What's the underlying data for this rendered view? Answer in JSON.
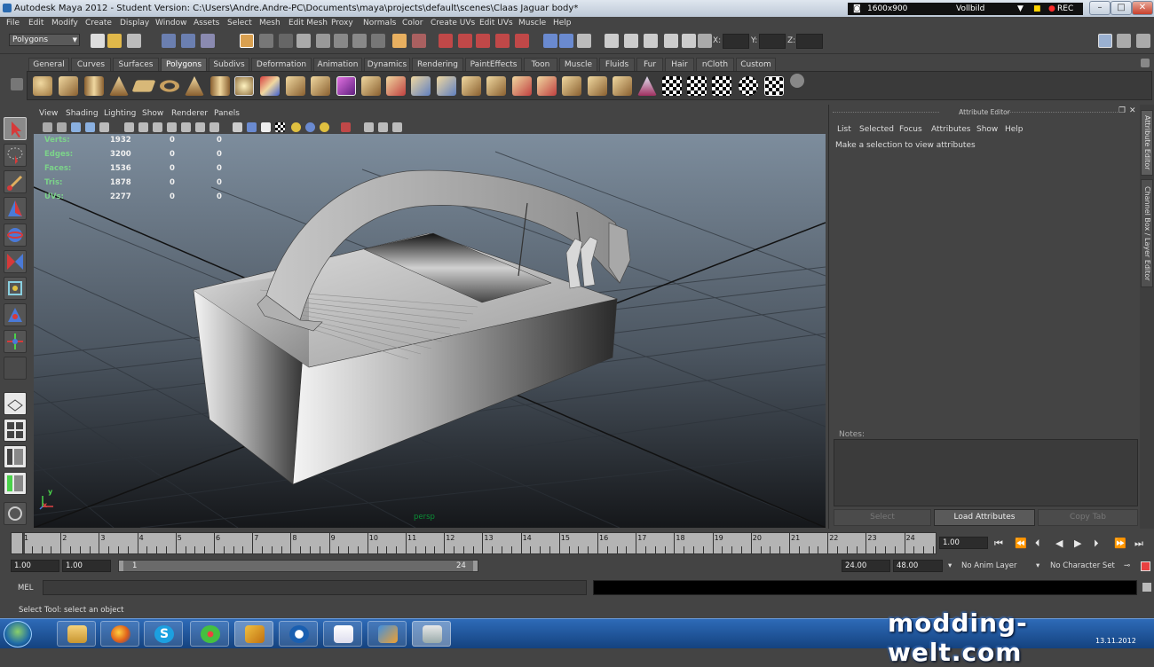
{
  "window": {
    "title": "Autodesk Maya 2012 - Student Version: C:\\Users\\Andre.Andre-PC\\Documents\\maya\\projects\\default\\scenes\\Claas Jaguar body*",
    "recorder": {
      "resolution": "1600x900",
      "mode": "Vollbild",
      "rec": "REC"
    },
    "controls": {
      "minimize": "–",
      "maximize": "□",
      "close": "✕"
    }
  },
  "menu": [
    "File",
    "Edit",
    "Modify",
    "Create",
    "Display",
    "Window",
    "Assets",
    "Select",
    "Mesh",
    "Edit Mesh",
    "Proxy",
    "Normals",
    "Color",
    "Create UVs",
    "Edit UVs",
    "Muscle",
    "Help"
  ],
  "status_line": {
    "mode": "Polygons",
    "x_label": "X:",
    "y_label": "Y:",
    "z_label": "Z:",
    "x_value": "",
    "y_value": "",
    "z_value": ""
  },
  "shelf": {
    "tabs": [
      "General",
      "Curves",
      "Surfaces",
      "Polygons",
      "Subdivs",
      "Deformation",
      "Animation",
      "Dynamics",
      "Rendering",
      "PaintEffects",
      "Toon",
      "Muscle",
      "Fluids",
      "Fur",
      "Hair",
      "nCloth",
      "Custom"
    ],
    "active_tab": "Polygons"
  },
  "viewport": {
    "menu": [
      "View",
      "Shading",
      "Lighting",
      "Show",
      "Renderer",
      "Panels"
    ],
    "camera": "persp",
    "stats": [
      {
        "label": "Verts:",
        "v1": "1932",
        "v2": "0",
        "v3": "0"
      },
      {
        "label": "Edges:",
        "v1": "3200",
        "v2": "0",
        "v3": "0"
      },
      {
        "label": "Faces:",
        "v1": "1536",
        "v2": "0",
        "v3": "0"
      },
      {
        "label": "Tris:",
        "v1": "1878",
        "v2": "0",
        "v3": "0"
      },
      {
        "label": "UVs:",
        "v1": "2277",
        "v2": "0",
        "v3": "0"
      }
    ],
    "axis_x": "x",
    "axis_y": "y"
  },
  "attribute_editor": {
    "title": "Attribute Editor",
    "menu": [
      "List",
      "Selected",
      "Focus",
      "Attributes",
      "Show",
      "Help"
    ],
    "message": "Make a selection to view attributes",
    "notes_label": "Notes:",
    "buttons": {
      "select": "Select",
      "load": "Load Attributes",
      "copy": "Copy Tab"
    }
  },
  "side_tabs": {
    "attribute_editor": "Attribute Editor",
    "channel_box": "Channel Box / Layer Editor"
  },
  "timeline": {
    "ticks": [
      "1",
      "2",
      "3",
      "4",
      "5",
      "6",
      "7",
      "8",
      "9",
      "10",
      "11",
      "12",
      "13",
      "14",
      "15",
      "16",
      "17",
      "18",
      "19",
      "20",
      "21",
      "22",
      "23",
      "24"
    ],
    "current_frame": "1.00",
    "playback_controls": [
      "⏮",
      "⏪",
      "⏴",
      "◀",
      "▶",
      "⏵",
      "⏩",
      "⏭"
    ]
  },
  "range": {
    "start_time": "1.00",
    "playback_start": "1.00",
    "slider_start": "1",
    "slider_end": "24",
    "playback_end": "24.00",
    "end_time": "48.00",
    "anim_layer": "No Anim Layer",
    "character_set": "No Character Set"
  },
  "command_line": {
    "label": "MEL",
    "value": ""
  },
  "help_line": "Select Tool: select an object",
  "taskbar": {
    "apps": [
      "explorer",
      "firefox",
      "skype",
      "icq",
      "winamp",
      "teamviewer",
      "notepad",
      "paint",
      "maya"
    ],
    "date": "13.11.2012"
  },
  "watermark": "modding-welt.com"
}
